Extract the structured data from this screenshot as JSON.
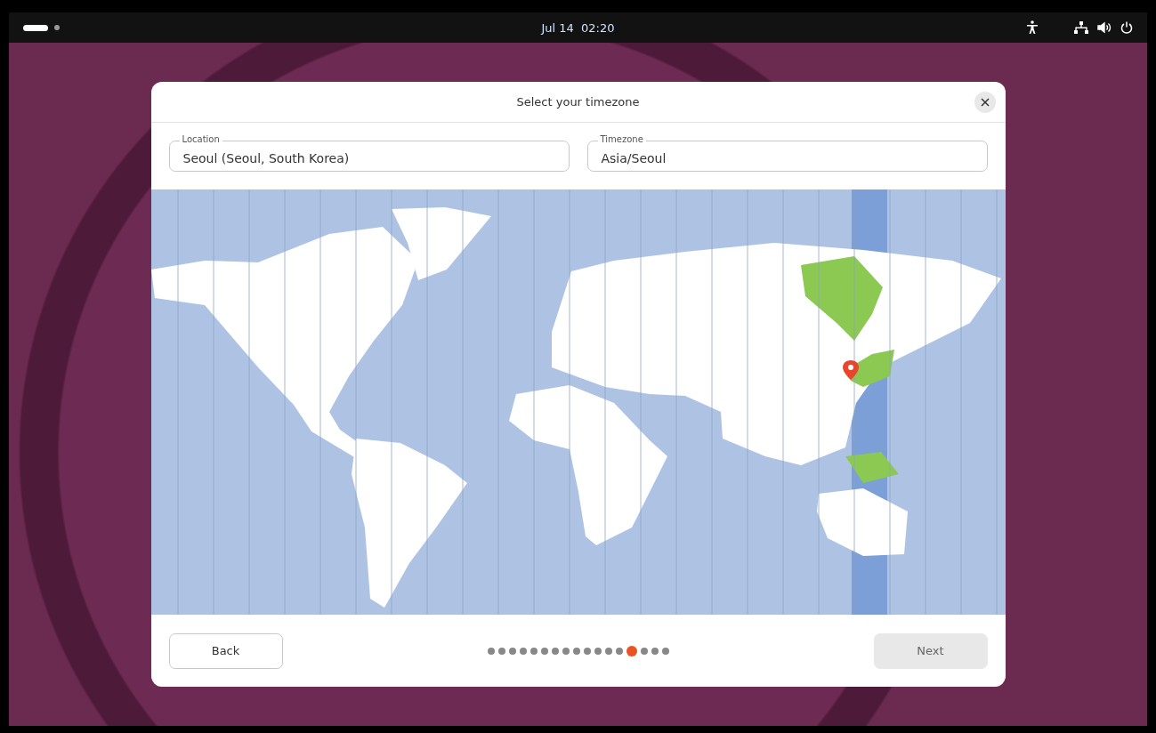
{
  "top_bar": {
    "clock": "Jul 14  02:20",
    "workspaces": [
      {
        "selected": true
      },
      {
        "selected": false
      }
    ]
  },
  "dialog": {
    "title": "Select your timezone",
    "fields": [
      {
        "label": "Location",
        "value": "Seoul (Seoul, South Korea)"
      },
      {
        "label": "Timezone",
        "value": "Asia/Seoul"
      }
    ],
    "footer": {
      "buttons": [
        {
          "label": "Back",
          "disabled": false
        },
        {
          "label": "Next",
          "disabled": true
        }
      ],
      "steps": [
        {
          "selected": false
        },
        {
          "selected": false
        },
        {
          "selected": false
        },
        {
          "selected": false
        },
        {
          "selected": false
        },
        {
          "selected": false
        },
        {
          "selected": false
        },
        {
          "selected": false
        },
        {
          "selected": false
        },
        {
          "selected": false
        },
        {
          "selected": false
        },
        {
          "selected": false
        },
        {
          "selected": false
        },
        {
          "selected": true
        },
        {
          "selected": false
        },
        {
          "selected": false
        },
        {
          "selected": false
        }
      ]
    }
  }
}
